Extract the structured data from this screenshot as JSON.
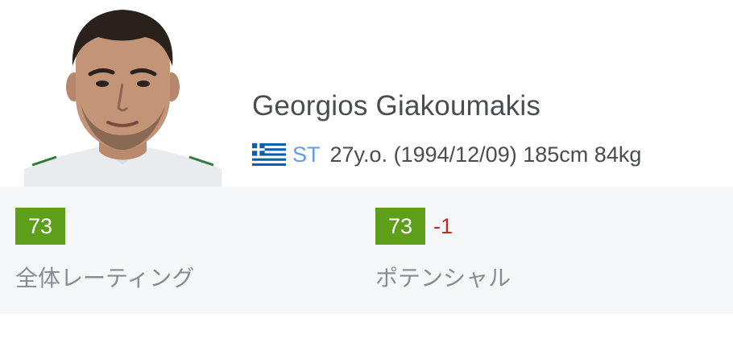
{
  "player": {
    "name": "Georgios Giakoumakis",
    "nationality_flag": "greece-flag-icon",
    "position": "ST",
    "age": "27y.o.",
    "birthdate": "(1994/12/09)",
    "height": "185cm",
    "weight": "84kg"
  },
  "ratings": {
    "overall": {
      "value": "73",
      "label": "全体レーティング"
    },
    "potential": {
      "value": "73",
      "delta": "-1",
      "label": "ポテンシャル"
    }
  },
  "colors": {
    "rating_green": "#5d9f1a",
    "position_blue": "#5c9ded",
    "delta_red": "#c62828",
    "panel_bg": "#f6f7f9"
  }
}
